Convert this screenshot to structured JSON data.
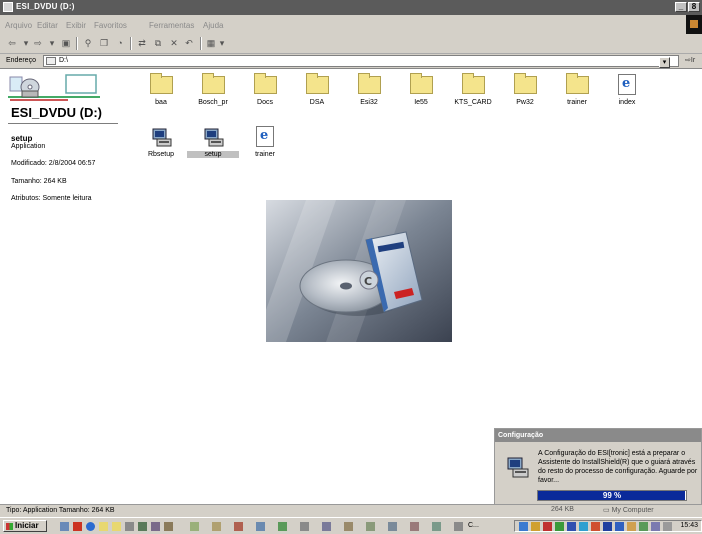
{
  "window": {
    "title": "ESI_DVDU (D:)",
    "controls": {
      "minimize": "_",
      "restore": "8"
    }
  },
  "menu": [
    "Arquivo",
    "Editar",
    "Exibir",
    "Favoritos",
    "Ferramentas",
    "Ajuda"
  ],
  "address": {
    "label": "Endereço",
    "value": "D:\\",
    "go_label": "Ir"
  },
  "left_panel": {
    "drive_title": "ESI_DVDU (D:)",
    "selected_name": "setup",
    "selected_type": "Application",
    "modified": "Modificado: 2/8/2004 06:57",
    "size": "Tamanho: 264 KB",
    "attributes": "Atributos: Somente leitura"
  },
  "files_row1": [
    {
      "name": "baa",
      "type": "folder"
    },
    {
      "name": "Bosch_pr",
      "type": "folder"
    },
    {
      "name": "Docs",
      "type": "folder"
    },
    {
      "name": "DSA",
      "type": "folder"
    },
    {
      "name": "Esi32",
      "type": "folder"
    },
    {
      "name": "Ie55",
      "type": "folder"
    },
    {
      "name": "KTS_CARD",
      "type": "folder"
    },
    {
      "name": "Pw32",
      "type": "folder"
    },
    {
      "name": "trainer",
      "type": "folder"
    },
    {
      "name": "index",
      "type": "html"
    }
  ],
  "files_row2": [
    {
      "name": "Rbsetup",
      "type": "setup"
    },
    {
      "name": "setup",
      "type": "setup"
    },
    {
      "name": "trainer",
      "type": "html"
    }
  ],
  "dialog": {
    "title": "Configuração",
    "message": "A Configuração do ESI[tronic] está a preparar o Assistente do InstallShield(R) que o guiará através do resto do processo de configuração. Aguarde por favor...",
    "progress_percent": 99,
    "progress_label": "99 %"
  },
  "status": {
    "text": "Tipo: Application Tamanho: 264 KB",
    "size": "264 KB",
    "zone": "My Computer"
  },
  "taskbar": {
    "start_label": "Iniciar",
    "task_label": "C...",
    "clock": "15:43"
  },
  "colors": {
    "titlebar": "#5b5b5b",
    "chrome": "#d4d0c8",
    "progress": "#0a2a9a",
    "folder": "#f4e48c"
  }
}
